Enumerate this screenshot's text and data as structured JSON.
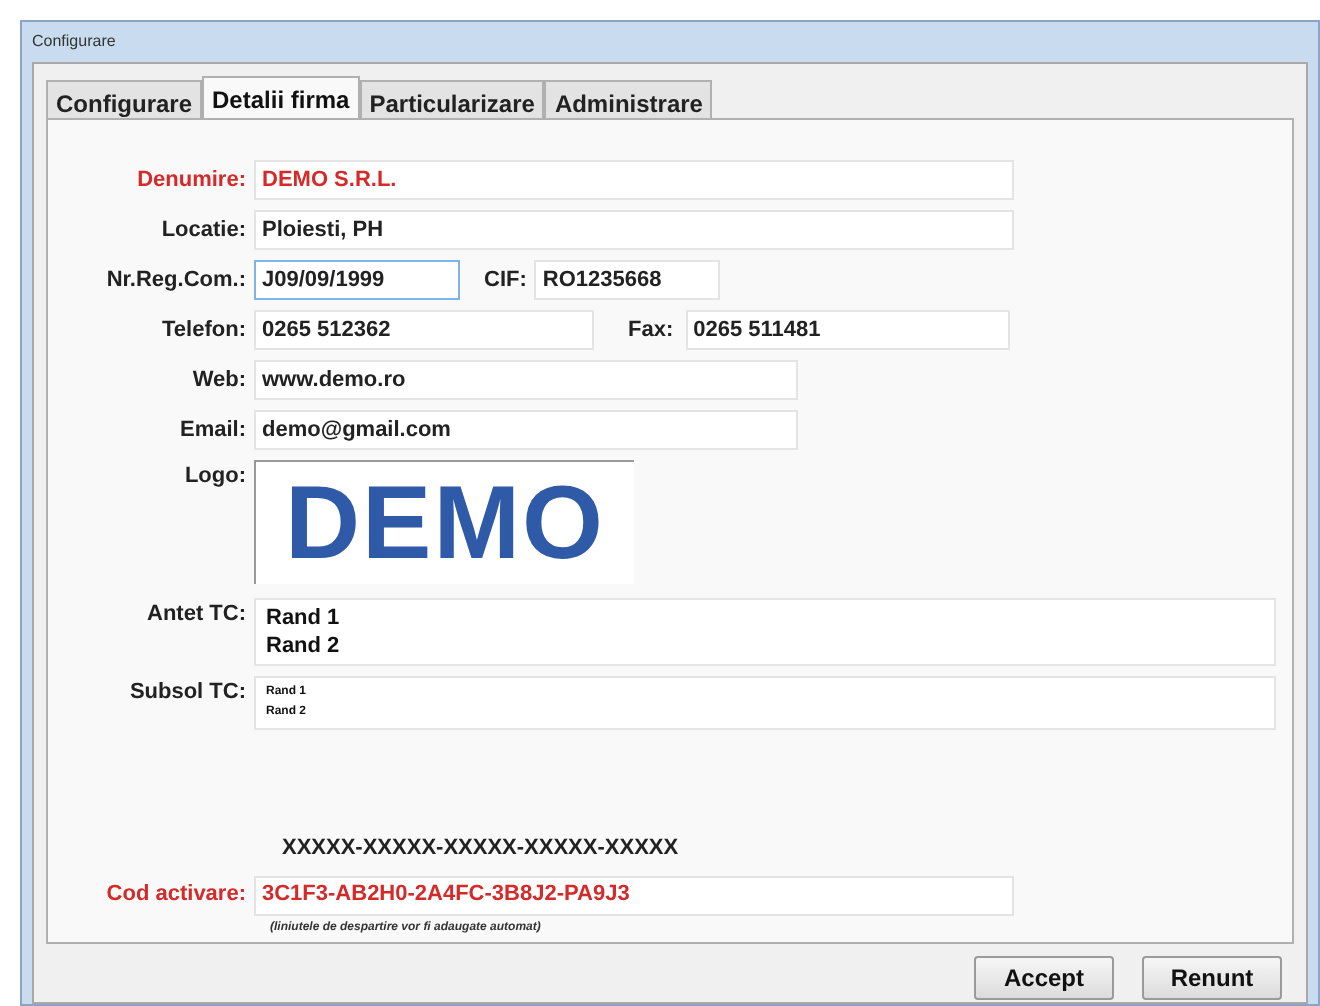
{
  "window": {
    "title": "Configurare"
  },
  "tabs": [
    {
      "label": "Configurare",
      "selected": false
    },
    {
      "label": "Detalii firma",
      "selected": true
    },
    {
      "label": "Particularizare",
      "selected": false
    },
    {
      "label": "Administrare",
      "selected": false
    }
  ],
  "fields": {
    "denumire": {
      "label": "Denumire:",
      "value": "DEMO S.R.L.",
      "required": true
    },
    "locatie": {
      "label": "Locatie:",
      "value": "Ploiesti, PH",
      "required": false
    },
    "nr_reg_com": {
      "label": "Nr.Reg.Com.:",
      "value": "J09/09/1999",
      "focused": true
    },
    "cif": {
      "label": "CIF:",
      "value": "RO1235668"
    },
    "telefon": {
      "label": "Telefon:",
      "value": "0265 512362"
    },
    "fax": {
      "label": "Fax:",
      "value": "0265 511481"
    },
    "web": {
      "label": "Web:",
      "value": "www.demo.ro"
    },
    "email": {
      "label": "Email:",
      "value": "demo@gmail.com"
    }
  },
  "logo": {
    "label": "Logo:",
    "text": "DEMO"
  },
  "antet_tc": {
    "label": "Antet TC:",
    "lines": [
      "Rand 1",
      "Rand 2"
    ]
  },
  "subsol_tc": {
    "label": "Subsol TC:",
    "lines": [
      "Rand 1",
      "Rand 2"
    ]
  },
  "activation": {
    "mask": "XXXXX-XXXXX-XXXXX-XXXXX-XXXXX",
    "label": "Cod activare:",
    "value": "3C1F3-AB2H0-2A4FC-3B8J2-PA9J3",
    "required": true,
    "hint": "(liniutele de despartire vor fi adaugate automat)"
  },
  "buttons": [
    "Accept",
    "Renunt"
  ]
}
